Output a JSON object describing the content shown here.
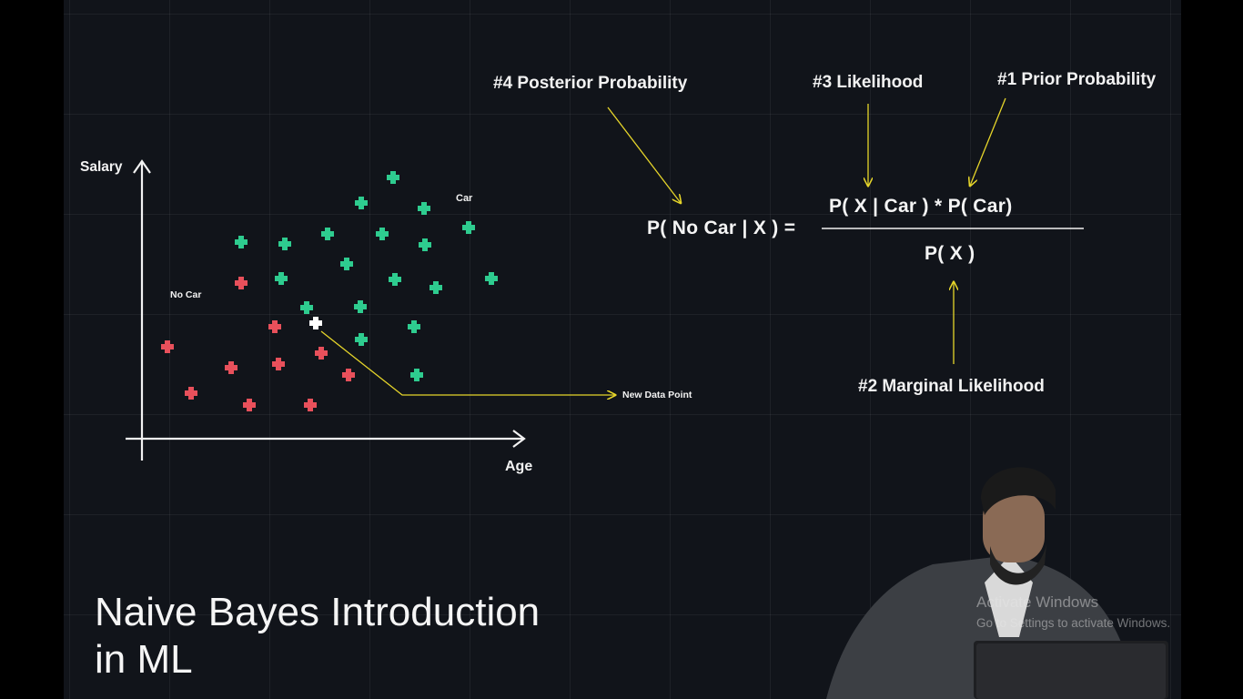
{
  "chart": {
    "y_axis_label": "Salary",
    "x_axis_label": "Age",
    "car_label": "Car",
    "no_car_label": "No Car",
    "new_point_label": "New Data Point",
    "colors": {
      "car": "#2ecc8f",
      "no_car": "#e8505b",
      "new_point": "#ffffff",
      "arrow": "#e6d52a",
      "axes": "#f2f2f2"
    }
  },
  "annotations": {
    "posterior": "#4 Posterior Probability",
    "likelihood": "#3 Likelihood",
    "prior": "#1 Prior Probability",
    "marginal": "#2 Marginal Likelihood"
  },
  "formula": {
    "lhs": "P( No Car | X ) =",
    "numerator": "P( X | Car ) * P( Car)",
    "denominator": "P( X )"
  },
  "title": {
    "line1": "Naive Bayes Introduction",
    "line2": "in ML"
  },
  "watermark": {
    "line1": "Activate Windows",
    "line2": "Go to Settings to activate Windows."
  },
  "presenter": {
    "icon": "person-icon"
  }
}
